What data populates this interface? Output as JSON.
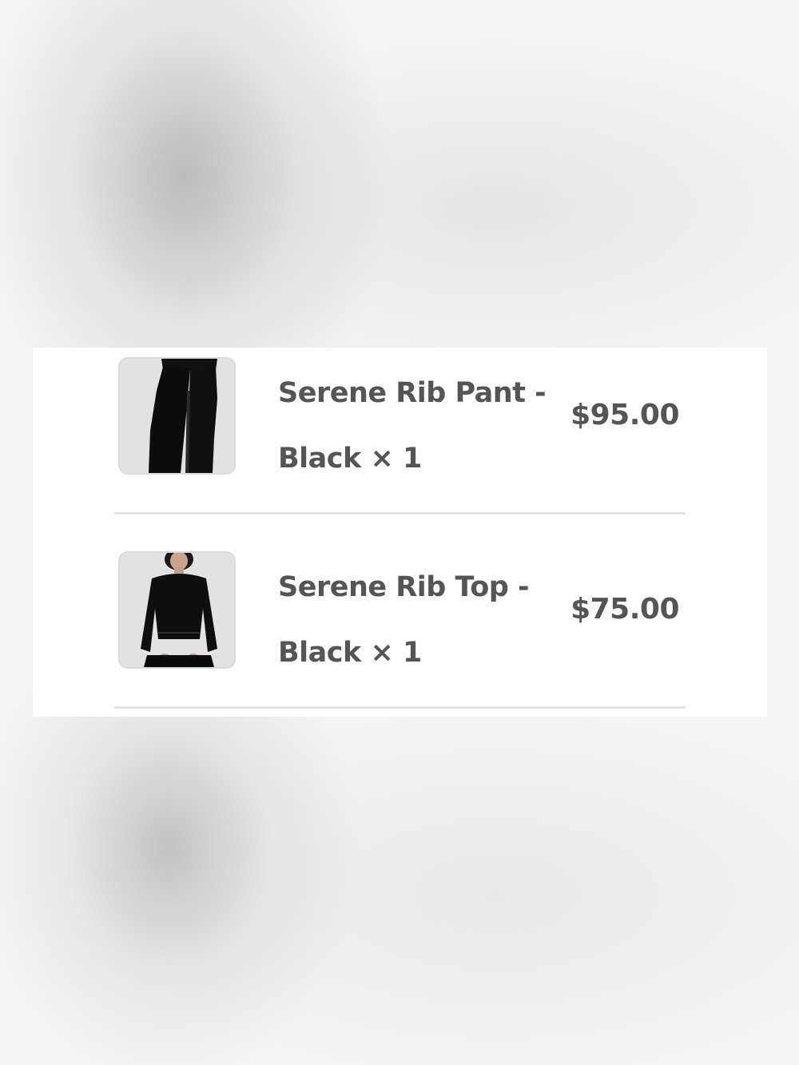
{
  "order_items": [
    {
      "name": "Serene Rib Pant -\nBlack × 1",
      "price": "$95.00",
      "image_icon": "black-pants-product-image"
    },
    {
      "name": "Serene Rib Top -\nBlack × 1",
      "price": "$75.00",
      "image_icon": "black-top-product-image"
    }
  ],
  "colors": {
    "text": "#555555",
    "panel": "#ffffff",
    "divider": "#e4e4e4",
    "thumb_bg": "#e2e2e2"
  }
}
